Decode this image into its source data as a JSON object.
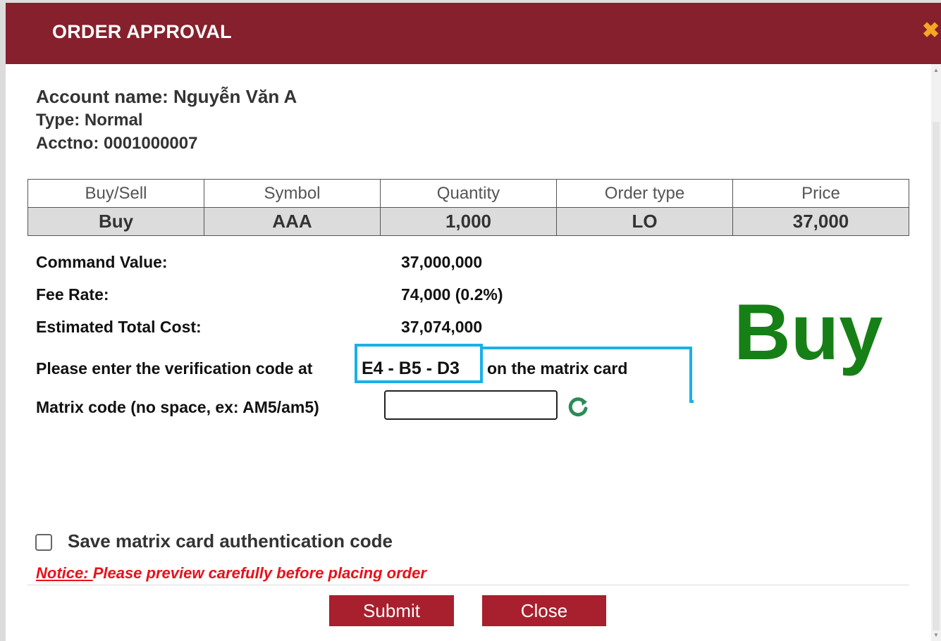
{
  "dialog": {
    "title": "ORDER APPROVAL",
    "close_glyph": "✖"
  },
  "account": {
    "name": "Account name: Nguyễn Văn A",
    "type": "Type: Normal",
    "acctno": "Acctno: 0001000007"
  },
  "order_table": {
    "headers": [
      "Buy/Sell",
      "Symbol",
      "Quantity",
      "Order type",
      "Price"
    ],
    "row": [
      "Buy",
      "AAA",
      "1,000",
      "LO",
      "37,000"
    ]
  },
  "summary": {
    "command_value_label": "Command Value:",
    "command_value": "37,000,000",
    "fee_rate_label": "Fee Rate:",
    "fee_rate": "74,000 (0.2%)",
    "total_cost_label": "Estimated Total Cost:",
    "total_cost": "37,074,000"
  },
  "verification": {
    "prefix": "Please enter the verification code at",
    "code": "E4 - B5 - D3",
    "suffix": "on the matrix card",
    "matrix_label": "Matrix code (no space, ex: AM5/am5)",
    "matrix_value": ""
  },
  "annotation": {
    "big_label": "Buy",
    "highlight_color": "#1ab0e8",
    "big_label_color": "#168016"
  },
  "save_option": {
    "label": "Save matrix card authentication code",
    "checked": false
  },
  "notice": {
    "prefix": "Notice: ",
    "text": "Please preview carefully before placing order"
  },
  "buttons": {
    "submit": "Submit",
    "close": "Close"
  },
  "colors": {
    "header": "#86202c",
    "button": "#a81f2d",
    "notice": "#e8101a",
    "refresh_icon": "#2e8b57"
  },
  "icons": {
    "close": "close-icon",
    "refresh": "refresh-icon"
  }
}
